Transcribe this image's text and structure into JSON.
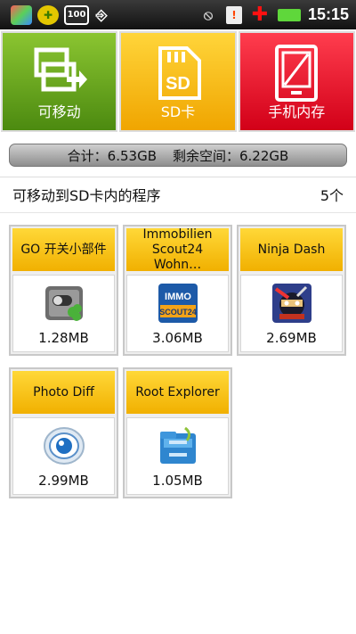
{
  "status_bar": {
    "time": "15:15",
    "left_icons": [
      "app-icon",
      "gear-icon",
      "battery-100-icon",
      "usb-icon"
    ],
    "right_icons": [
      "no-alarm-icon",
      "warning-icon",
      "red-cross-icon",
      "battery-icon"
    ],
    "battery_label": "100"
  },
  "tabs": [
    {
      "label": "可移动",
      "icon": "phone-to-card-icon",
      "color": "#6aa620"
    },
    {
      "label": "SD卡",
      "icon": "sd-card-icon",
      "color": "#f5bd16"
    },
    {
      "label": "手机内存",
      "icon": "phone-memory-icon",
      "color": "#e6081f"
    }
  ],
  "summary": {
    "total": "合计：6.53GB",
    "free": "剩余空间：6.22GB"
  },
  "movable": {
    "label": "可移动到SD卡内的程序",
    "count": "5个"
  },
  "apps": [
    {
      "name": "GO 开关小部件",
      "size": "1.28MB",
      "icon": "go-switch-widget-icon"
    },
    {
      "name": "Immobilien Scout24 Wohn…",
      "size": "3.06MB",
      "icon": "immoscout24-icon",
      "icon_text_top": "IMMO",
      "icon_text_bottom": "SCOUT24"
    },
    {
      "name": "Ninja Dash",
      "size": "2.69MB",
      "icon": "ninja-dash-icon"
    },
    {
      "name": "Photo Diff",
      "size": "2.99MB",
      "icon": "photo-diff-icon"
    },
    {
      "name": "Root Explorer",
      "size": "1.05MB",
      "icon": "root-explorer-icon"
    }
  ]
}
